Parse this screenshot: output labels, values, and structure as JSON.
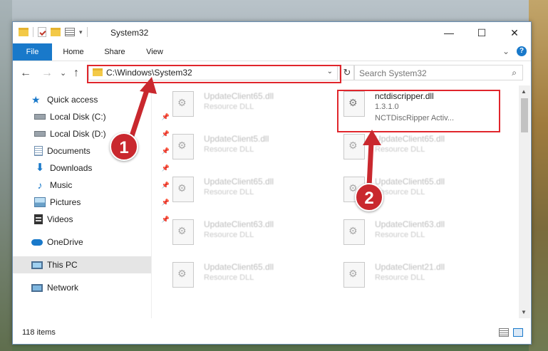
{
  "window": {
    "title": "System32",
    "minimize_glyph": "—",
    "maximize_glyph": "☐",
    "close_glyph": "✕"
  },
  "ribbon": {
    "tabs": [
      "File",
      "Home",
      "Share",
      "View"
    ],
    "expand_glyph": "⌄",
    "help_glyph": "?"
  },
  "navbar": {
    "back_glyph": "←",
    "forward_glyph": "→",
    "recent_glyph": "⌄",
    "up_glyph": "↑",
    "address": "C:\\Windows\\System32",
    "address_dropdown_glyph": "⌄",
    "refresh_glyph": "↻",
    "search_placeholder": "Search System32",
    "search_glyph": "⌕"
  },
  "sidebar": {
    "items": [
      {
        "label": "Quick access",
        "icon": "star-icon"
      },
      {
        "label": "Local Disk (C:)",
        "icon": "drive-icon",
        "pinned": true
      },
      {
        "label": "Local Disk (D:)",
        "icon": "drive-icon",
        "pinned": true
      },
      {
        "label": "Documents",
        "icon": "documents-icon",
        "pinned": true
      },
      {
        "label": "Downloads",
        "icon": "download-icon",
        "pinned": true
      },
      {
        "label": "Music",
        "icon": "music-icon",
        "pinned": true
      },
      {
        "label": "Pictures",
        "icon": "pictures-icon",
        "pinned": true
      },
      {
        "label": "Videos",
        "icon": "videos-icon",
        "pinned": true
      },
      {
        "label": "OneDrive",
        "icon": "cloud-icon"
      },
      {
        "label": "This PC",
        "icon": "computer-icon",
        "selected": true
      },
      {
        "label": "Network",
        "icon": "network-icon"
      }
    ],
    "pin_glyph": "📌"
  },
  "files": {
    "left_column": [
      {
        "name": "UpdateClient65.dll",
        "type": "Resource DLL"
      },
      {
        "name": "UpdateClient5.dll",
        "type": "Resource DLL"
      },
      {
        "name": "UpdateClient65.dll",
        "type": "Resource DLL"
      },
      {
        "name": "UpdateClient63.dll",
        "type": "Resource DLL"
      },
      {
        "name": "UpdateClient65.dll",
        "type": "Resource DLL"
      }
    ],
    "right_column": [
      {
        "name": "UpdateClient65.dll",
        "type": "Resource DLL"
      },
      {
        "name": "UpdateClient65.dll",
        "type": "Resource DLL"
      },
      {
        "name": "UpdateClient63.dll",
        "type": "Resource DLL"
      },
      {
        "name": "UpdateClient21.dll",
        "type": "Resource DLL"
      }
    ],
    "featured": {
      "name": "nctdiscripper.dll",
      "version": "1.3.1.0",
      "description": "NCTDiscRipper Activ..."
    }
  },
  "status": {
    "item_count": "118 items"
  },
  "annotations": {
    "step1": "1",
    "step2": "2",
    "highlight_color": "#e0262c"
  }
}
